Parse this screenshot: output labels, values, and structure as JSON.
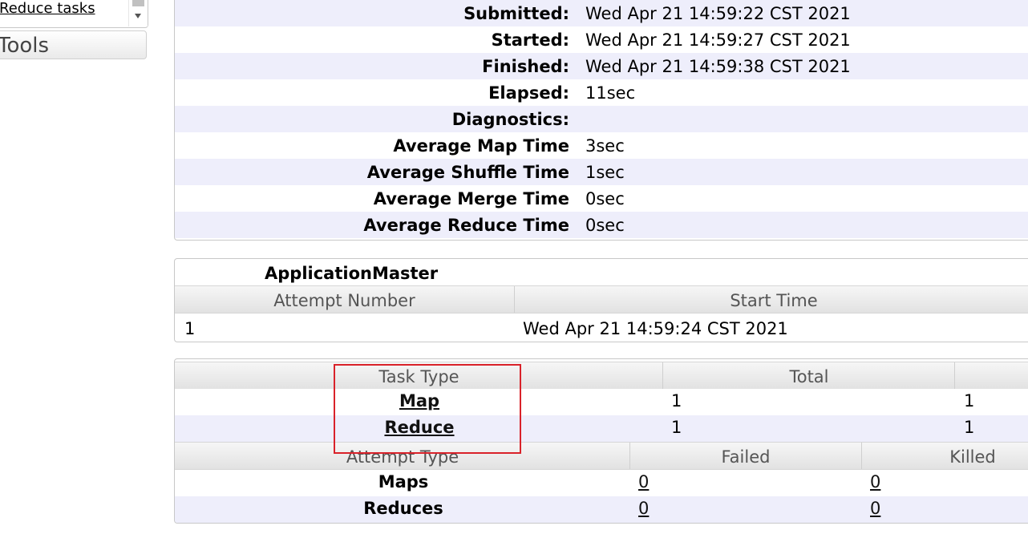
{
  "sidebar": {
    "nav_link": "Reduce tasks",
    "tools_label": "Tools"
  },
  "job_info": [
    {
      "label": "Submitted:",
      "value": "Wed Apr 21 14:59:22 CST 2021"
    },
    {
      "label": "Started:",
      "value": "Wed Apr 21 14:59:27 CST 2021"
    },
    {
      "label": "Finished:",
      "value": "Wed Apr 21 14:59:38 CST 2021"
    },
    {
      "label": "Elapsed:",
      "value": "11sec"
    },
    {
      "label": "Diagnostics:",
      "value": ""
    },
    {
      "label": "Average Map Time",
      "value": "3sec"
    },
    {
      "label": "Average Shuffle Time",
      "value": "1sec"
    },
    {
      "label": "Average Merge Time",
      "value": "0sec"
    },
    {
      "label": "Average Reduce Time",
      "value": "0sec"
    }
  ],
  "application_master": {
    "title": "ApplicationMaster",
    "columns": [
      "Attempt Number",
      "Start Time"
    ],
    "rows": [
      {
        "attempt": "1",
        "start_time": "Wed Apr 21 14:59:24 CST 2021"
      }
    ]
  },
  "tasks": {
    "columns": [
      "Task Type",
      "Total"
    ],
    "rows": [
      {
        "type": "Map",
        "total": "1",
        "extra": "1"
      },
      {
        "type": "Reduce",
        "total": "1",
        "extra": "1"
      }
    ]
  },
  "attempts": {
    "columns": [
      "Attempt Type",
      "Failed",
      "Killed"
    ],
    "rows": [
      {
        "type": "Maps",
        "failed": "0",
        "killed": "0"
      },
      {
        "type": "Reduces",
        "failed": "0",
        "killed": "0"
      }
    ]
  },
  "colors": {
    "highlight": "#d9222a",
    "row_stripe": "#eeeefb",
    "header_gradient_bottom": "#e2e2e2"
  }
}
